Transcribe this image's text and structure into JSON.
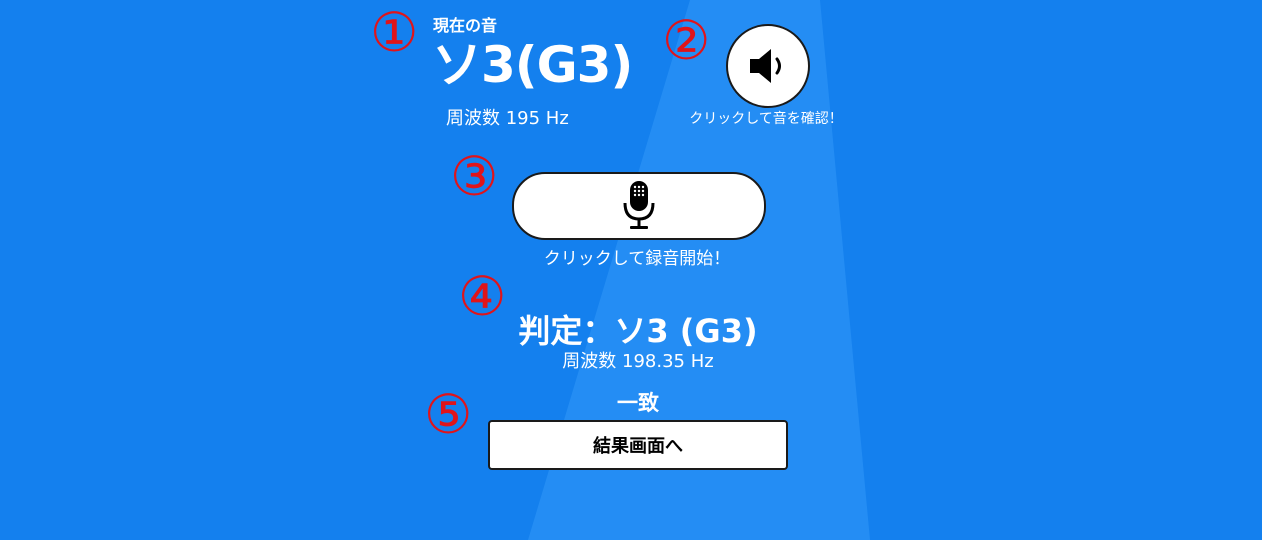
{
  "current": {
    "label": "現在の音",
    "note": "ソ3(G3)",
    "frequency": "周波数 195 Hz"
  },
  "play_sound": {
    "icon": "speaker-icon",
    "caption": "クリックして音を確認！"
  },
  "record": {
    "icon": "microphone-icon",
    "caption": "クリックして録音開始！"
  },
  "result": {
    "verdict": "判定：ソ3 (G3)",
    "frequency": "周波数 198.35 Hz",
    "match": "一致"
  },
  "result_button": {
    "label": "結果画面へ"
  },
  "annotations": [
    "①",
    "②",
    "③",
    "④",
    "⑤"
  ],
  "colors": {
    "background": "#1480ee",
    "annotation": "#e0141a",
    "button_bg": "#ffffff",
    "button_border": "#1a1a1a"
  }
}
